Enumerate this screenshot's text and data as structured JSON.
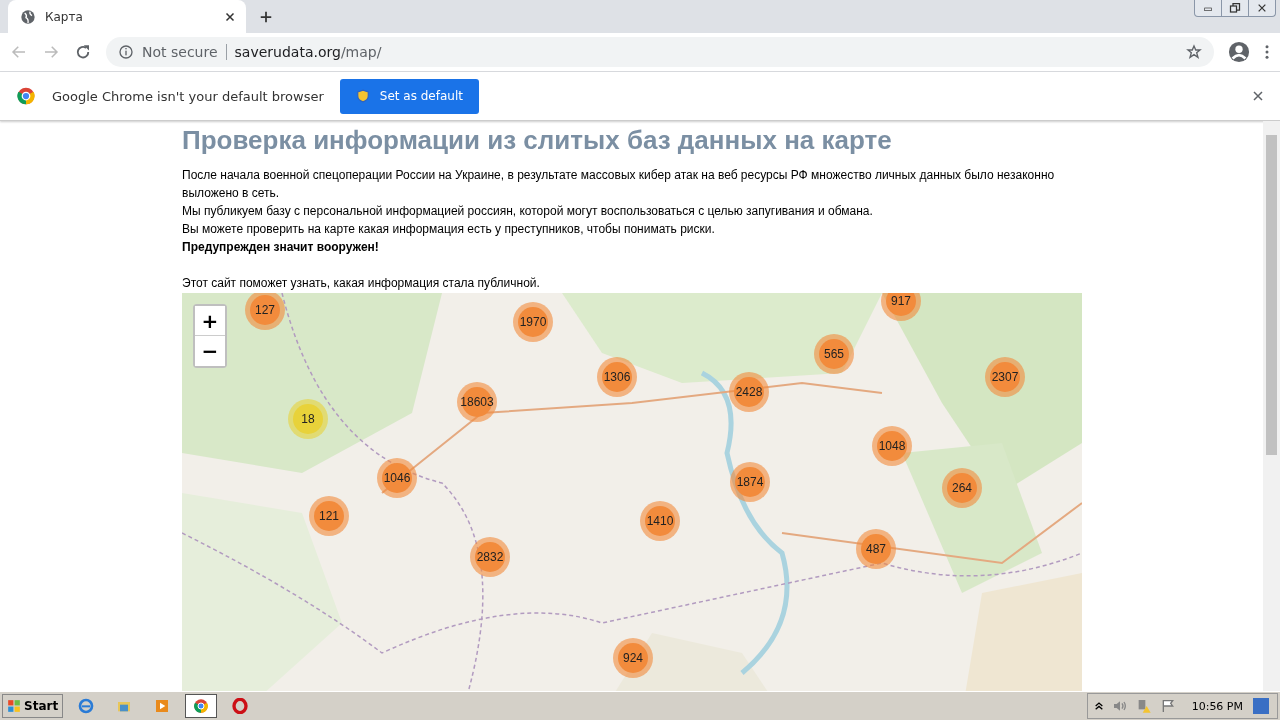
{
  "browser": {
    "tab": {
      "title": "Карта",
      "selected": true
    },
    "address": {
      "security": "Not secure",
      "host": "saverudata.org",
      "path": "/map/"
    },
    "infobar": {
      "message": "Google Chrome isn't your default browser",
      "button": "Set as default"
    }
  },
  "page": {
    "heading": "Проверка информации из слитых баз данных на карте",
    "paragraphs": [
      {
        "text": "После начала военной спецоперации России на Украине, в результате массовых кибер атак на веб ресурсы РФ множество личных данных было незаконно выложено в сеть.",
        "bold": false
      },
      {
        "text": "Мы публикуем базу с персональной информацией россиян, которой могут воспользоваться с целью запугивания и обмана.",
        "bold": false
      },
      {
        "text": "Вы можете проверить на карте какая информация есть у преступников, чтобы понимать риски.",
        "bold": false
      },
      {
        "text": "Предупрежден значит вооружен!",
        "bold": true
      }
    ],
    "note": "Этот сайт поможет узнать, какая информация стала публичной.",
    "map": {
      "zoom_in": "+",
      "zoom_out": "−",
      "clusters": [
        {
          "count": "127",
          "color": "#f28b3c"
        },
        {
          "count": "1970",
          "color": "#f28b3c"
        },
        {
          "count": "917",
          "color": "#f28b3c"
        },
        {
          "count": "565",
          "color": "#f28b3c"
        },
        {
          "count": "1306",
          "color": "#f28b3c"
        },
        {
          "count": "2428",
          "color": "#f28b3c"
        },
        {
          "count": "2307",
          "color": "#f28b3c"
        },
        {
          "count": "18603",
          "color": "#f28b3c"
        },
        {
          "count": "18",
          "color": "#e8d23a"
        },
        {
          "count": "1048",
          "color": "#f28b3c"
        },
        {
          "count": "1046",
          "color": "#f28b3c"
        },
        {
          "count": "1874",
          "color": "#f28b3c"
        },
        {
          "count": "264",
          "color": "#f28b3c"
        },
        {
          "count": "121",
          "color": "#f28b3c"
        },
        {
          "count": "1410",
          "color": "#f28b3c"
        },
        {
          "count": "2832",
          "color": "#f28b3c"
        },
        {
          "count": "487",
          "color": "#f28b3c"
        },
        {
          "count": "924",
          "color": "#f28b3c"
        }
      ]
    }
  },
  "taskbar": {
    "start": "Start",
    "apps": [
      {
        "kind": "ie",
        "selected": false
      },
      {
        "kind": "folder",
        "selected": false
      },
      {
        "kind": "media",
        "selected": false
      },
      {
        "kind": "chrome",
        "selected": true
      },
      {
        "kind": "opera",
        "selected": false
      }
    ],
    "clock": "10:56 PM"
  }
}
